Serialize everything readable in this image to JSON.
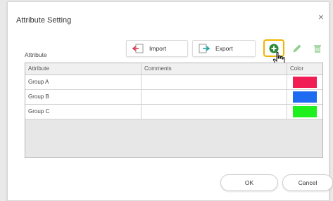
{
  "dialog": {
    "title": "Attribute Setting",
    "close_symbol": "×",
    "section_label": "Attribute"
  },
  "toolbar": {
    "import_label": "Import",
    "export_label": "Export"
  },
  "table": {
    "headers": [
      "Attribute",
      "Comments",
      "Color"
    ],
    "rows": [
      {
        "attribute": "Group A",
        "comments": "",
        "color": "#f01e55"
      },
      {
        "attribute": "Group B",
        "comments": "",
        "color": "#1e6af0"
      },
      {
        "attribute": "Group C",
        "comments": "",
        "color": "#1ef01e"
      }
    ]
  },
  "footer": {
    "ok_label": "OK",
    "cancel_label": "Cancel"
  },
  "colors": {
    "highlight": "#f0b400",
    "add_green": "#2e8b3a"
  }
}
